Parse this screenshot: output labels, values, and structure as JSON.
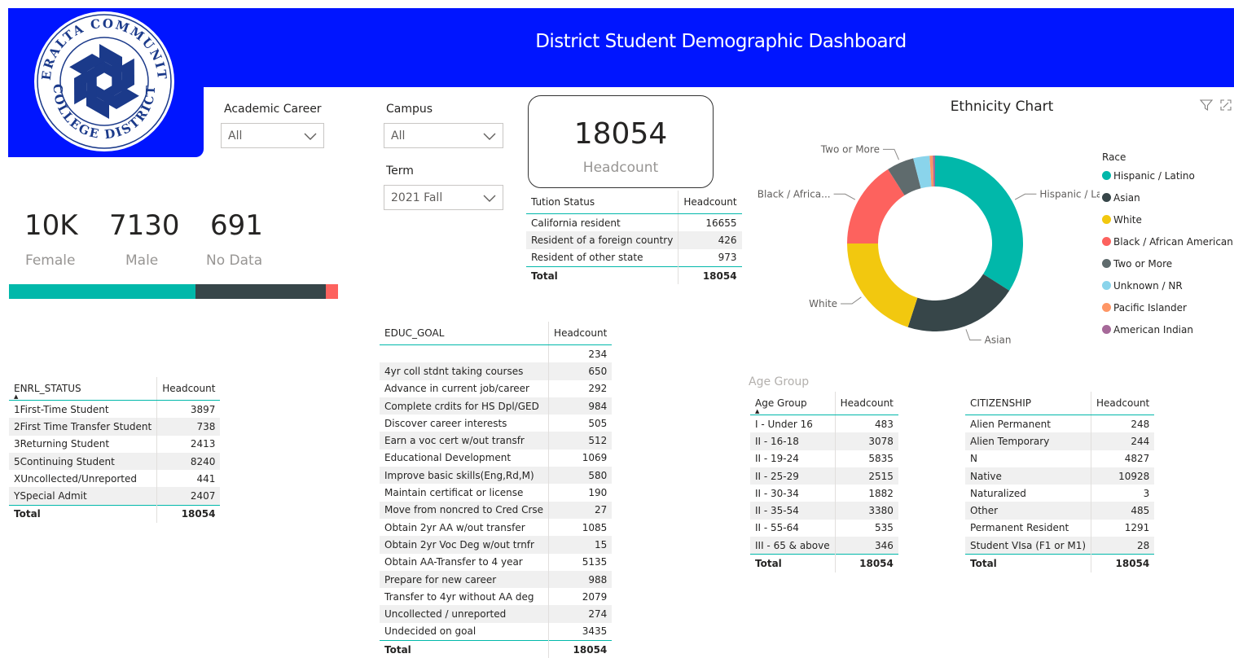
{
  "header": {
    "title": "District Student Demographic Dashboard"
  },
  "logo": {
    "top_text": "PERALTA COMMUNITY",
    "bottom_text": "COLLEGE DISTRICT"
  },
  "filters": {
    "academic_career": {
      "label": "Academic Career",
      "value": "All"
    },
    "campus": {
      "label": "Campus",
      "value": "All"
    },
    "term": {
      "label": "Term",
      "value": "2021 Fall"
    }
  },
  "headcount_card": {
    "value": "18054",
    "label": "Headcount"
  },
  "gender": {
    "female": {
      "value": "10K",
      "label": "Female"
    },
    "male": {
      "value": "7130",
      "label": "Male"
    },
    "nodata": {
      "value": "691",
      "label": "No Data"
    },
    "bar": [
      {
        "name": "Female",
        "value": 10233,
        "color": "#01B8AA"
      },
      {
        "name": "Male",
        "value": 7130,
        "color": "#374649"
      },
      {
        "name": "No Data",
        "value": 691,
        "color": "#FD625E"
      }
    ]
  },
  "tuition": {
    "headers": [
      "Tution Status",
      "Headcount"
    ],
    "rows": [
      [
        "California resident",
        "16655"
      ],
      [
        "Resident of a foreign country",
        "426"
      ],
      [
        "Resident of other state",
        "973"
      ]
    ],
    "total": [
      "Total",
      "18054"
    ]
  },
  "enrl": {
    "headers": [
      "ENRL_STATUS",
      "Headcount"
    ],
    "rows": [
      [
        "1First-Time Student",
        "3897"
      ],
      [
        "2First Time Transfer Student",
        "738"
      ],
      [
        "3Returning Student",
        "2413"
      ],
      [
        "5Continuing Student",
        "8240"
      ],
      [
        "XUncollected/Unreported",
        "441"
      ],
      [
        "YSpecial Admit",
        "2407"
      ]
    ],
    "total": [
      "Total",
      "18054"
    ]
  },
  "educ": {
    "headers": [
      "EDUC_GOAL",
      "Headcount"
    ],
    "rows": [
      [
        "",
        "234"
      ],
      [
        "4yr coll stdnt taking courses",
        "650"
      ],
      [
        "Advance in current job/career",
        "292"
      ],
      [
        "Complete crdits for HS Dpl/GED",
        "984"
      ],
      [
        "Discover career interests",
        "505"
      ],
      [
        "Earn a voc cert w/out transfr",
        "512"
      ],
      [
        "Educational Development",
        "1069"
      ],
      [
        "Improve basic skills(Eng,Rd,M)",
        "580"
      ],
      [
        "Maintain certificat or license",
        "190"
      ],
      [
        "Move from noncred to Cred Crse",
        "27"
      ],
      [
        "Obtain 2yr AA w/out transfer",
        "1085"
      ],
      [
        "Obtain 2yr Voc Deg w/out trnfr",
        "15"
      ],
      [
        "Obtain AA-Transfer to 4 year",
        "5135"
      ],
      [
        "Prepare for new career",
        "988"
      ],
      [
        "Transfer to 4yr without AA deg",
        "2079"
      ],
      [
        "Uncollected / unreported",
        "274"
      ],
      [
        "Undecided on goal",
        "3435"
      ]
    ],
    "total": [
      "Total",
      "18054"
    ]
  },
  "age": {
    "title": "Age Group",
    "headers": [
      "Age Group",
      "Headcount"
    ],
    "rows": [
      [
        "I - Under 16",
        "483"
      ],
      [
        "II - 16-18",
        "3078"
      ],
      [
        "II - 19-24",
        "5835"
      ],
      [
        "II - 25-29",
        "2515"
      ],
      [
        "II - 30-34",
        "1882"
      ],
      [
        "II - 35-54",
        "3380"
      ],
      [
        "II - 55-64",
        "535"
      ],
      [
        "III - 65 & above",
        "346"
      ]
    ],
    "total": [
      "Total",
      "18054"
    ]
  },
  "citizenship": {
    "headers": [
      "CITIZENSHIP",
      "Headcount"
    ],
    "rows": [
      [
        "Alien Permanent",
        "248"
      ],
      [
        "Alien Temporary",
        "244"
      ],
      [
        "N",
        "4827"
      ],
      [
        "Native",
        "10928"
      ],
      [
        "Naturalized",
        "3"
      ],
      [
        "Other",
        "485"
      ],
      [
        "Permanent Resident",
        "1291"
      ],
      [
        "Student VIsa (F1 or M1)",
        "28"
      ]
    ],
    "total": [
      "Total",
      "18054"
    ]
  },
  "chart_data": {
    "type": "pie",
    "title": "Ethnicity Chart",
    "legend_title": "Race",
    "legend_position": "right",
    "slices": [
      {
        "name": "Hispanic / Latino",
        "value": 34,
        "color": "#01B8AA",
        "label": "Hispanic / Latino"
      },
      {
        "name": "Asian",
        "value": 21,
        "color": "#374649",
        "label": "Asian"
      },
      {
        "name": "White",
        "value": 20,
        "color": "#F2C80F",
        "label": "White"
      },
      {
        "name": "Black / African American",
        "value": 16,
        "color": "#FD625E",
        "label": "Black / Africa..."
      },
      {
        "name": "Two or More",
        "value": 5,
        "color": "#5F6B6D",
        "label": "Two or More"
      },
      {
        "name": "Unknown / NR",
        "value": 3,
        "color": "#8AD4EB",
        "label": ""
      },
      {
        "name": "Pacific Islander",
        "value": 0.6,
        "color": "#FE9666",
        "label": ""
      },
      {
        "name": "American Indian",
        "value": 0.4,
        "color": "#A66999",
        "label": ""
      }
    ]
  }
}
